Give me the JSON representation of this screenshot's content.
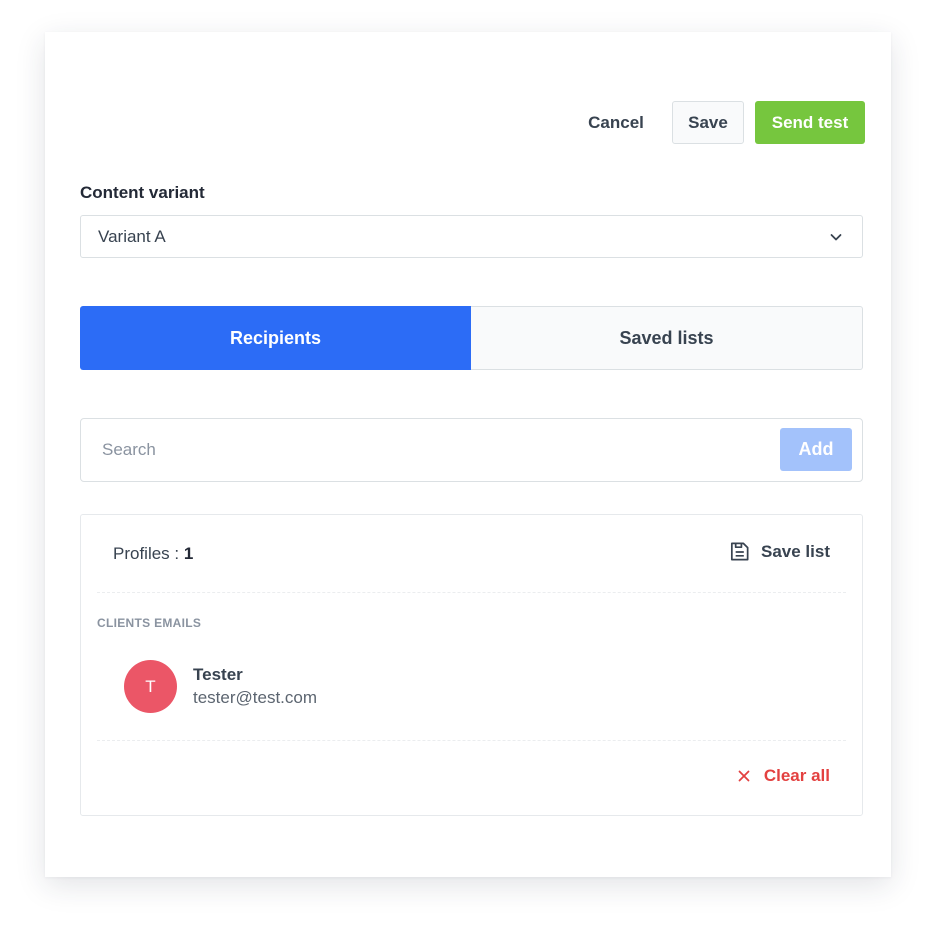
{
  "toolbar": {
    "cancel_label": "Cancel",
    "save_label": "Save",
    "send_test_label": "Send test"
  },
  "content_variant": {
    "label": "Content variant",
    "selected": "Variant A"
  },
  "tabs": [
    {
      "label": "Recipients",
      "active": true
    },
    {
      "label": "Saved lists",
      "active": false
    }
  ],
  "search": {
    "placeholder": "Search",
    "value": "",
    "add_label": "Add"
  },
  "profiles": {
    "label": "Profiles : ",
    "count": "1",
    "save_list_label": "Save list"
  },
  "section_title": "CLIENTS EMAILS",
  "contacts": [
    {
      "initial": "T",
      "name": "Tester",
      "email": "tester@test.com"
    }
  ],
  "clear_all_label": "Clear all",
  "icons": {
    "dropdown": "chevron-down-icon",
    "save_list": "save-list-icon",
    "clear": "close-icon"
  },
  "colors": {
    "primary": "#2c6cf6",
    "success": "#76c63e",
    "danger": "#e34140",
    "avatar": "#eb5667",
    "add_disabled": "#a3c2fb"
  }
}
